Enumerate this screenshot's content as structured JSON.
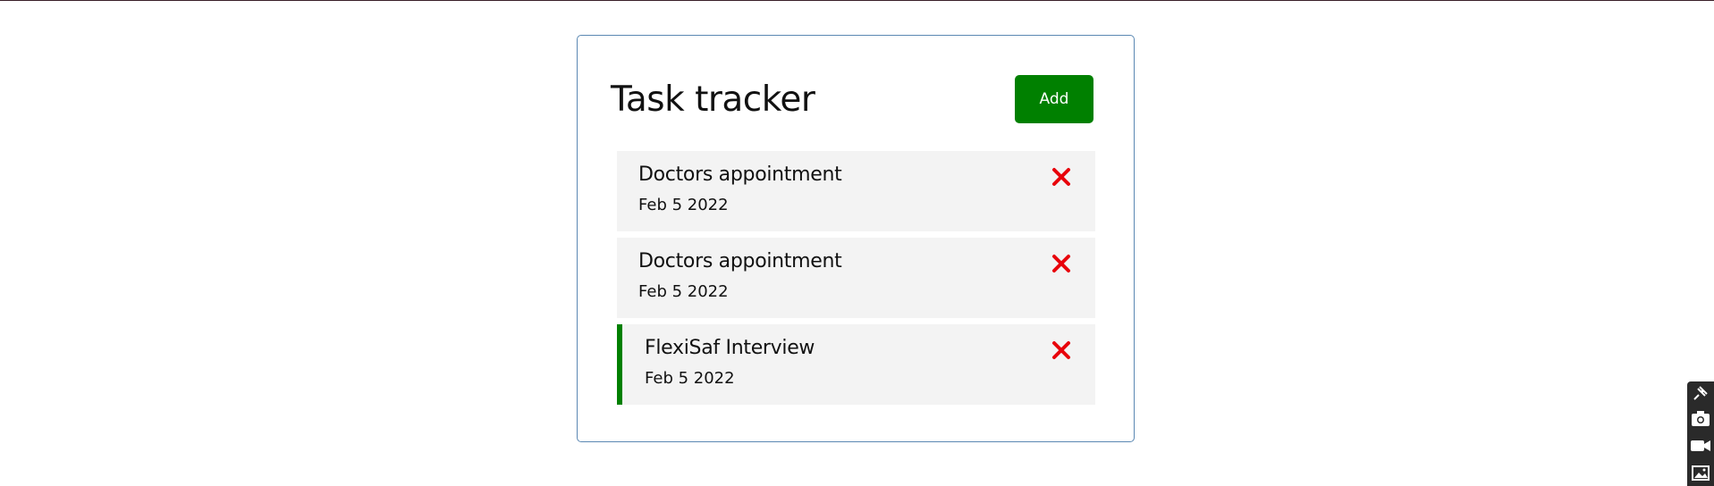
{
  "app": {
    "title": "Task tracker",
    "add_label": "Add"
  },
  "tasks": [
    {
      "name": "Doctors appointment",
      "date": "Feb 5 2022",
      "reminder": false
    },
    {
      "name": "Doctors appointment",
      "date": "Feb 5 2022",
      "reminder": false
    },
    {
      "name": "FlexiSaf Interview",
      "date": "Feb 5 2022",
      "reminder": true
    }
  ],
  "icons": {
    "delete": "close-icon",
    "toolbar": [
      "pin-icon",
      "camera-icon",
      "video-icon",
      "image-icon"
    ]
  },
  "colors": {
    "accent": "#008000",
    "delete": "#e8000b",
    "card_bg": "#f3f3f3",
    "container_border": "#5b88b3"
  }
}
